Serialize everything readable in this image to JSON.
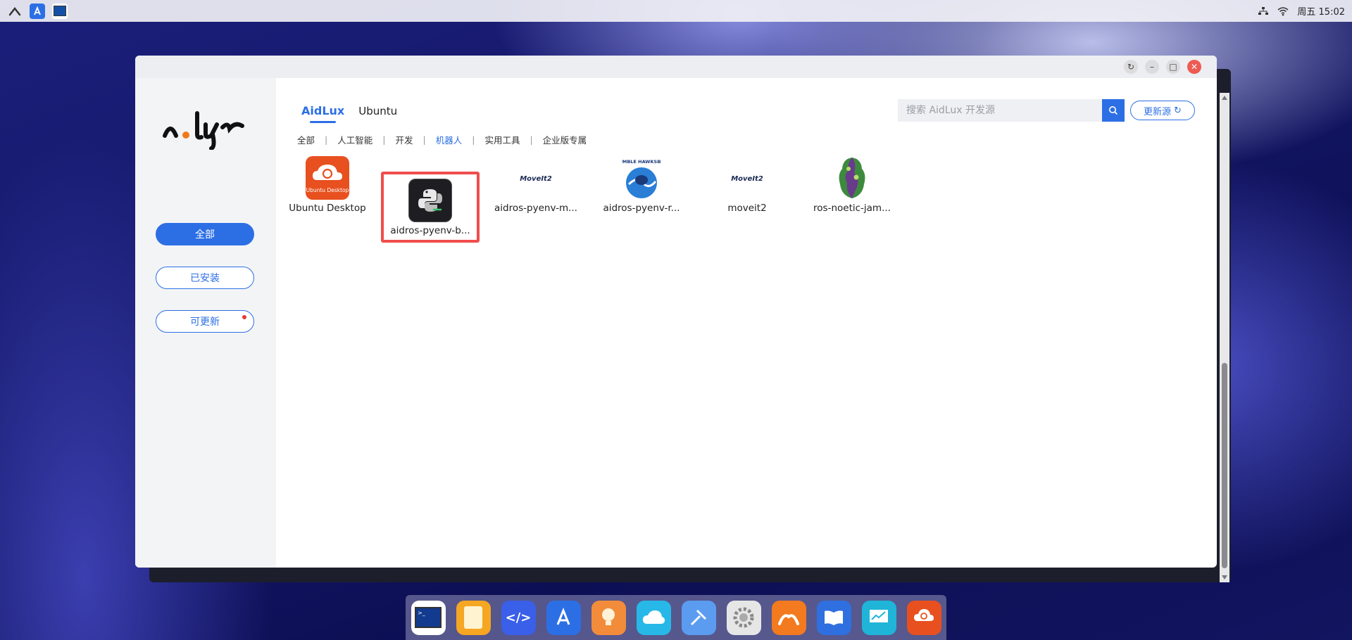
{
  "topbar": {
    "apps": [
      "aidlux-logo-icon",
      "app-store-icon",
      "terminal-icon"
    ],
    "clock": "周五 15:02"
  },
  "window": {
    "controls": [
      "refresh-icon",
      "minimize-icon",
      "maximize-icon",
      "close-icon"
    ]
  },
  "sidebar": {
    "items": [
      {
        "label": "全部",
        "active": true
      },
      {
        "label": "已安装",
        "active": false
      },
      {
        "label": "可更新",
        "active": false,
        "badge": true
      }
    ]
  },
  "tabs": [
    {
      "label": "AidLux",
      "active": true
    },
    {
      "label": "Ubuntu",
      "active": false
    }
  ],
  "search": {
    "placeholder": "搜索 AidLux 开发源"
  },
  "update_button": {
    "label": "更新源"
  },
  "categories": [
    {
      "label": "全部",
      "active": false
    },
    {
      "label": "人工智能",
      "active": false
    },
    {
      "label": "开发",
      "active": false
    },
    {
      "label": "机器人",
      "active": true
    },
    {
      "label": "实用工具",
      "active": false
    },
    {
      "label": "企业版专属",
      "active": false
    }
  ],
  "apps": [
    {
      "name": "Ubuntu Desktop",
      "icon": "ubuntu-desktop-icon",
      "icon_text": "Ubuntu Desktop"
    },
    {
      "name": "aidros-pyenv-b...",
      "icon": "python-terminal-icon",
      "selected": true
    },
    {
      "name": "aidros-pyenv-m...",
      "icon": "moveit2-icon",
      "icon_text": "MoveIt2"
    },
    {
      "name": "aidros-pyenv-r...",
      "icon": "humble-hawksbill-icon",
      "icon_text": "HUMBLE HAWKSBILL"
    },
    {
      "name": "moveit2",
      "icon": "moveit2-icon",
      "icon_text": "MoveIt2"
    },
    {
      "name": "ros-noetic-jam...",
      "icon": "ros-noetic-icon"
    }
  ],
  "dock": [
    "terminal-icon",
    "files-icon",
    "code-icon",
    "app-store-icon",
    "bulb-icon",
    "cloud-icon",
    "tools-icon",
    "settings-icon",
    "aidlux-icon",
    "docs-icon",
    "monitor-icon",
    "ubuntu-desktop-icon"
  ],
  "colors": {
    "accent": "#2c6fe5",
    "close": "#ee5b52",
    "highlight": "#f04d4d"
  }
}
